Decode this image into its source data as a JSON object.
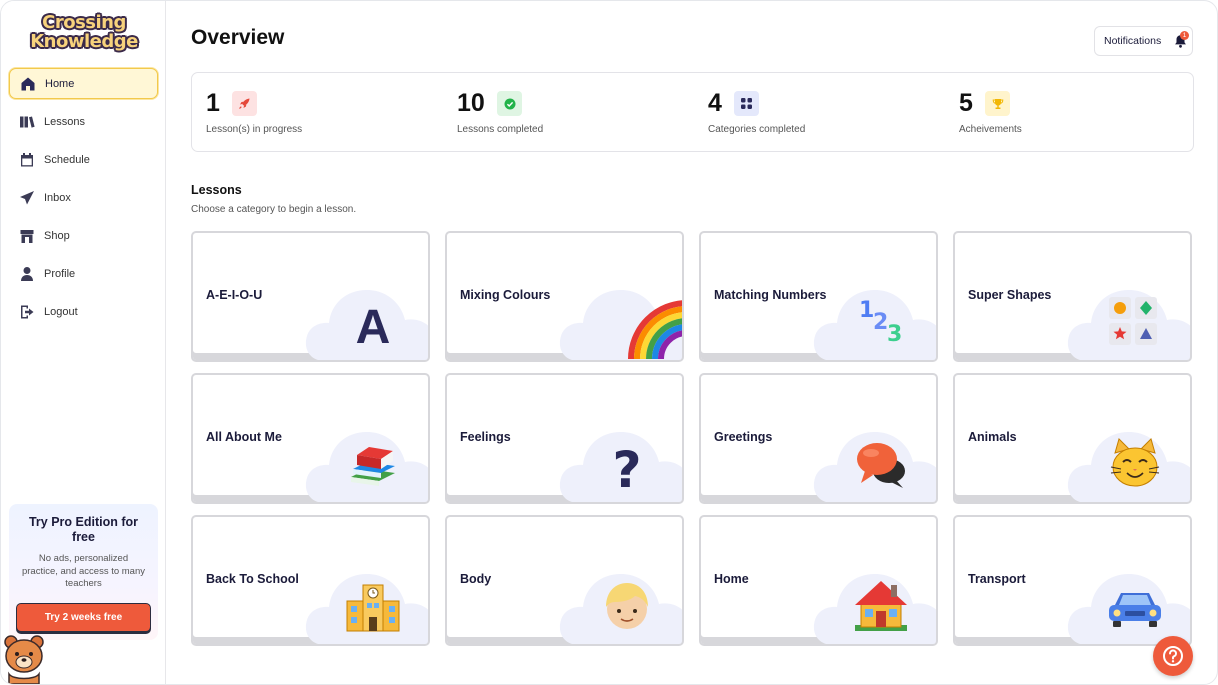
{
  "brand": {
    "line1": "Crossing",
    "line2": "Knowledge"
  },
  "sidebar": {
    "items": [
      {
        "label": "Home",
        "icon": "home-icon",
        "active": true
      },
      {
        "label": "Lessons",
        "icon": "book-icon"
      },
      {
        "label": "Schedule",
        "icon": "calendar-icon"
      },
      {
        "label": "Inbox",
        "icon": "paper-plane-icon"
      },
      {
        "label": "Shop",
        "icon": "store-icon"
      },
      {
        "label": "Profile",
        "icon": "user-icon"
      },
      {
        "label": "Logout",
        "icon": "logout-icon"
      }
    ]
  },
  "promo": {
    "title": "Try Pro Edition for free",
    "text": "No ads, personalized practice, and access to many teachers",
    "button": "Try 2 weeks free"
  },
  "header": {
    "title": "Overview",
    "notifications_label": "Notifications",
    "notification_count": "1"
  },
  "stats": [
    {
      "value": "1",
      "label": "Lesson(s) in progress",
      "icon": "rocket-icon",
      "color": "#fde2e2"
    },
    {
      "value": "10",
      "label": "Lessons completed",
      "icon": "check-circle-icon",
      "color": "#dff5e3"
    },
    {
      "value": "4",
      "label": "Categories completed",
      "icon": "grid-icon",
      "color": "#e4e8fb"
    },
    {
      "value": "5",
      "label": "Acheivements",
      "icon": "trophy-icon",
      "color": "#fff4cc"
    }
  ],
  "lessons": {
    "title": "Lessons",
    "subtitle": "Choose a category to begin a lesson.",
    "cards": [
      {
        "title": "A-E-I-O-U",
        "icon": "letter-a-icon"
      },
      {
        "title": "Mixing Colours",
        "icon": "rainbow-icon"
      },
      {
        "title": "Matching Numbers",
        "icon": "numbers-123-icon"
      },
      {
        "title": "Super Shapes",
        "icon": "shapes-icon"
      },
      {
        "title": "All About Me",
        "icon": "books-icon"
      },
      {
        "title": "Feelings",
        "icon": "question-mark-icon"
      },
      {
        "title": "Greetings",
        "icon": "speech-bubbles-icon"
      },
      {
        "title": "Animals",
        "icon": "cat-face-icon"
      },
      {
        "title": "Back To School",
        "icon": "school-icon"
      },
      {
        "title": "Body",
        "icon": "child-face-icon"
      },
      {
        "title": "Home",
        "icon": "house-icon"
      },
      {
        "title": "Transport",
        "icon": "car-icon"
      }
    ]
  },
  "colors": {
    "accent": "#ee5a3b",
    "active_nav": "#fff7d6",
    "navy": "#1b1b3a",
    "cloud": "#eef0fb"
  }
}
